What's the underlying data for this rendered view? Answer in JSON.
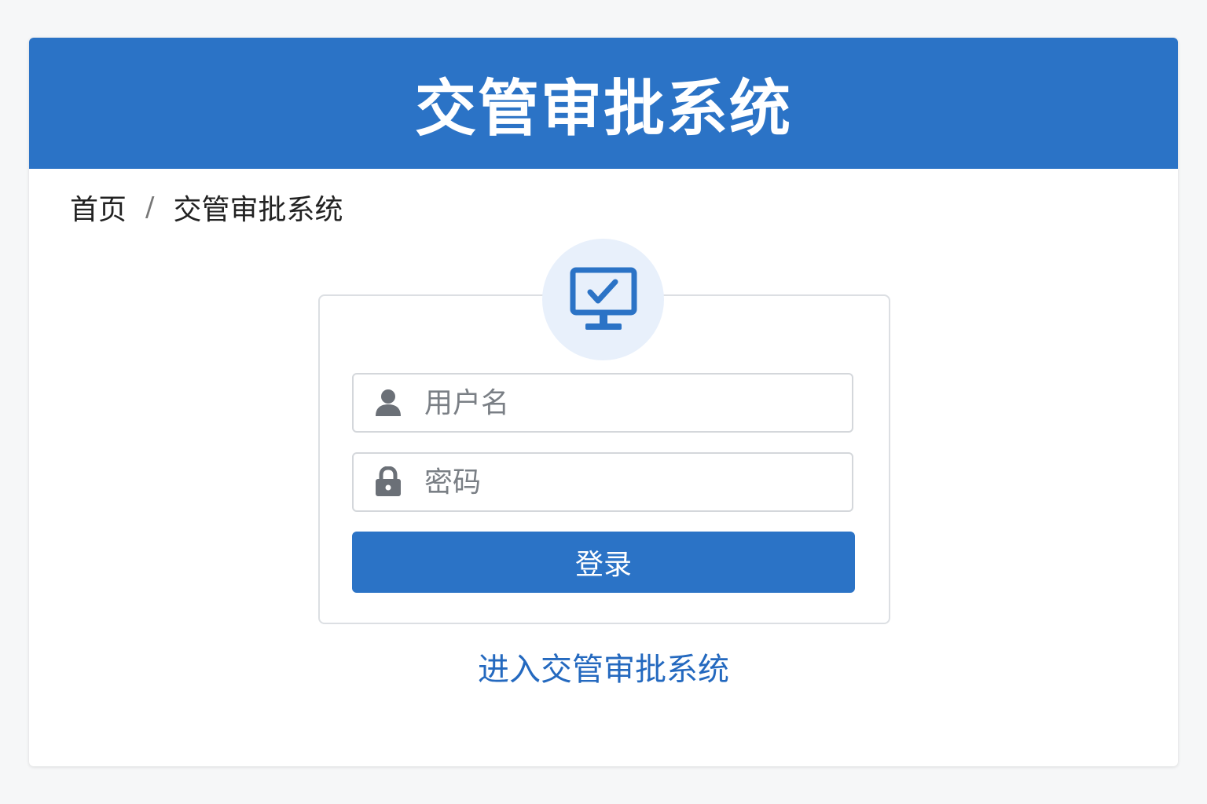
{
  "header": {
    "title": "交管审批系统"
  },
  "breadcrumb": {
    "home": "首页",
    "separator": "/",
    "current": "交管审批系统"
  },
  "login": {
    "username_placeholder": "用户名",
    "password_placeholder": "密码",
    "submit_label": "登录"
  },
  "footer_link": {
    "label": "进入交管审批系统"
  },
  "icons": {
    "header_icon": "monitor-check-icon",
    "username_icon": "user-icon",
    "password_icon": "lock-icon"
  },
  "colors": {
    "primary": "#2b73c6",
    "link": "#2469bf",
    "icon_bg": "#e8f0fb",
    "icon_gray": "#6b7077"
  }
}
